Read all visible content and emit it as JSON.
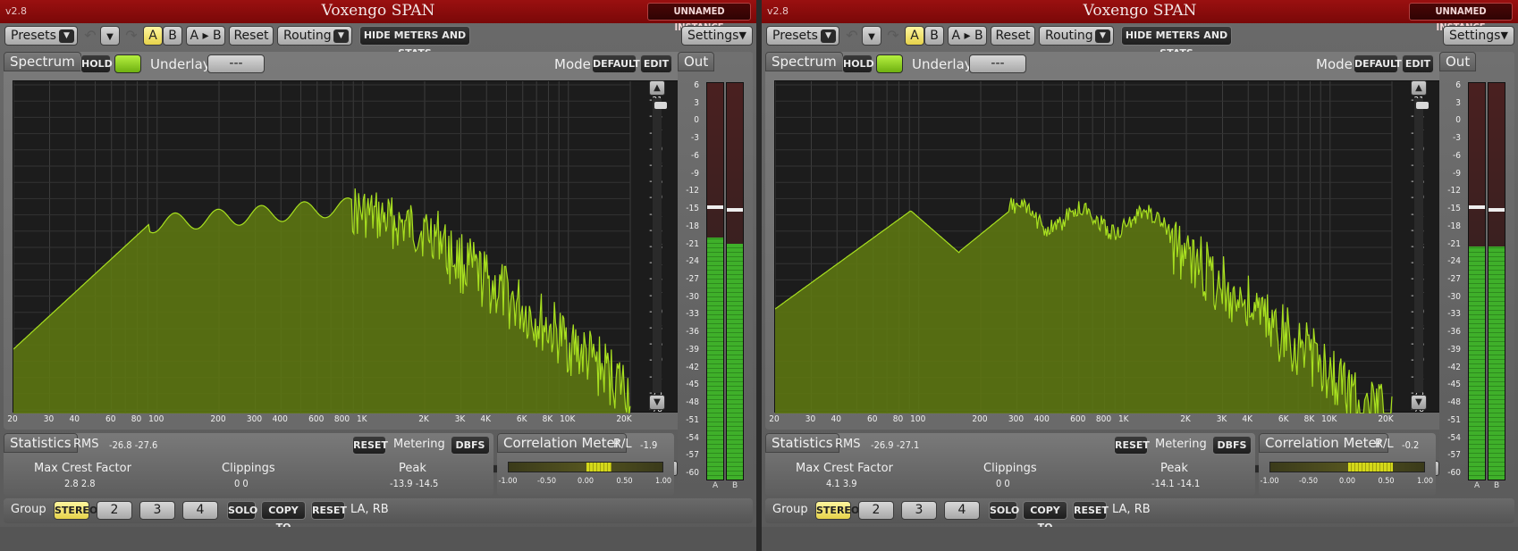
{
  "instances": [
    {
      "version": "v2.8",
      "title": "Voxengo SPAN",
      "instance_label": "UNNAMED INSTANCE",
      "toolbar": {
        "presets": "Presets",
        "a": "A",
        "b": "B",
        "a_to_b": "A ▸ B",
        "reset": "Reset",
        "routing": "Routing",
        "hide_meters": "HIDE METERS AND STATS",
        "settings": "Settings"
      },
      "spectrum": {
        "tab": "Spectrum",
        "hold": "HOLD",
        "underlay_label": "Underlay",
        "underlay_value": "---",
        "mode_label": "Mode",
        "mode_value": "DEFAULT",
        "edit": "EDIT",
        "db_ticks": [
          "-18",
          "-21",
          "-24",
          "-27",
          "-30",
          "-33",
          "-36",
          "-39",
          "-42",
          "-45",
          "-48",
          "-51",
          "-54",
          "-57",
          "-60",
          "-63",
          "-66",
          "-69",
          "-72",
          "-75",
          "-78"
        ],
        "freq_ticks": [
          "20",
          "30",
          "40",
          "60",
          "80",
          "100",
          "200",
          "300",
          "400",
          "600",
          "800",
          "1K",
          "2K",
          "3K",
          "4K",
          "6K",
          "8K",
          "10K",
          "20K"
        ]
      },
      "out": {
        "tab": "Out",
        "ticks": [
          "6",
          "3",
          "0",
          "-3",
          "-6",
          "-9",
          "-12",
          "-15",
          "-18",
          "-21",
          "-24",
          "-27",
          "-30",
          "-33",
          "-36",
          "-39",
          "-42",
          "-45",
          "-48",
          "-51",
          "-54",
          "-57",
          "-60"
        ],
        "channel_a": "A",
        "channel_b": "B",
        "level_a_db": -20,
        "level_b_db": -21,
        "peak_a_db": -14.5,
        "peak_b_db": -15
      },
      "statistics": {
        "tab": "Statistics",
        "rms_label": "RMS",
        "rms_values": "-26.8  -27.6",
        "reset": "RESET",
        "metering_label": "Metering",
        "metering_value": "DBFS",
        "crest_label": "Max Crest Factor",
        "crest_values": "2.8    2.8",
        "clippings_label": "Clippings",
        "clippings_values": "0      0",
        "peak_label": "Peak",
        "peak_values": "-13.9  -14.5"
      },
      "correlation": {
        "tab": "Correlation Meter",
        "rl_label": "R/L",
        "rl_value": "-1.9",
        "ticks": [
          "-1.00",
          "-0.50",
          "0.00",
          "0.50",
          "1.00"
        ],
        "fill_from": 0.0,
        "fill_to": 0.32
      },
      "group": {
        "label": "Group",
        "stereo": "STEREO",
        "g2": "2",
        "g3": "3",
        "g4": "4",
        "solo": "SOLO",
        "copy_to": "COPY TO",
        "reset": "RESET",
        "channels": "LA, RB"
      }
    },
    {
      "version": "v2.8",
      "title": "Voxengo SPAN",
      "instance_label": "UNNAMED INSTANCE",
      "toolbar": {
        "presets": "Presets",
        "a": "A",
        "b": "B",
        "a_to_b": "A ▸ B",
        "reset": "Reset",
        "routing": "Routing",
        "hide_meters": "HIDE METERS AND STATS",
        "settings": "Settings"
      },
      "spectrum": {
        "tab": "Spectrum",
        "hold": "HOLD",
        "underlay_label": "Underlay",
        "underlay_value": "---",
        "mode_label": "Mode",
        "mode_value": "DEFAULT",
        "edit": "EDIT",
        "db_ticks": [
          "-18",
          "-21",
          "-24",
          "-27",
          "-30",
          "-33",
          "-36",
          "-39",
          "-42",
          "-45",
          "-48",
          "-51",
          "-54",
          "-57",
          "-60",
          "-63",
          "-66",
          "-69",
          "-72",
          "-75",
          "-78"
        ],
        "freq_ticks": [
          "20",
          "30",
          "40",
          "60",
          "80",
          "100",
          "200",
          "300",
          "400",
          "600",
          "800",
          "1K",
          "2K",
          "3K",
          "4K",
          "6K",
          "8K",
          "10K",
          "20K"
        ]
      },
      "out": {
        "tab": "Out",
        "ticks": [
          "6",
          "3",
          "0",
          "-3",
          "-6",
          "-9",
          "-12",
          "-15",
          "-18",
          "-21",
          "-24",
          "-27",
          "-30",
          "-33",
          "-36",
          "-39",
          "-42",
          "-45",
          "-48",
          "-51",
          "-54",
          "-57",
          "-60"
        ],
        "channel_a": "A",
        "channel_b": "B",
        "level_a_db": -21.5,
        "level_b_db": -21.5,
        "peak_a_db": -14.5,
        "peak_b_db": -15
      },
      "statistics": {
        "tab": "Statistics",
        "rms_label": "RMS",
        "rms_values": "-26.9  -27.1",
        "reset": "RESET",
        "metering_label": "Metering",
        "metering_value": "DBFS",
        "crest_label": "Max Crest Factor",
        "crest_values": "4.1    3.9",
        "clippings_label": "Clippings",
        "clippings_values": "0      0",
        "peak_label": "Peak",
        "peak_values": "-14.1  -14.1"
      },
      "correlation": {
        "tab": "Correlation Meter",
        "rl_label": "R/L",
        "rl_value": "-0.2",
        "ticks": [
          "-1.00",
          "-0.50",
          "0.00",
          "0.50",
          "1.00"
        ],
        "fill_from": 0.0,
        "fill_to": 0.58
      },
      "group": {
        "label": "Group",
        "stereo": "STEREO",
        "g2": "2",
        "g3": "3",
        "g4": "4",
        "solo": "SOLO",
        "copy_to": "COPY TO",
        "reset": "RESET",
        "channels": "LA, RB"
      }
    }
  ]
}
